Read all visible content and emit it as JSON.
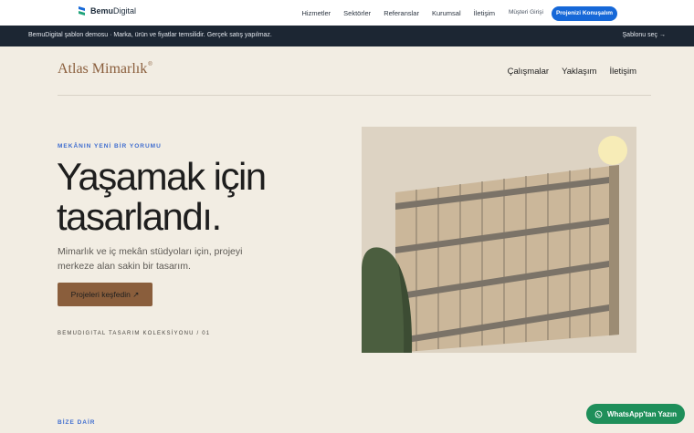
{
  "topnav": {
    "brand_bold": "Bemu",
    "brand_rest": "Digital",
    "links": [
      "Hizmetler",
      "Sektörler",
      "Referanslar",
      "Kurumsal",
      "İletişim"
    ],
    "login": "Müşteri Girişi",
    "cta": "Projenizi Konuşalım"
  },
  "banner": {
    "text": "BemuDigital şablon demosu · Marka, ürün ve fiyatlar temsilidir. Gerçek satış yapılmaz.",
    "link": "Şablonu seç →"
  },
  "site": {
    "logo": "Atlas Mimarlık",
    "logo_mark": "®",
    "nav": [
      "Çalışmalar",
      "Yaklaşım",
      "İletişim"
    ]
  },
  "hero": {
    "eyebrow": "MEKÂNIN YENİ BİR YORUMU",
    "headline_line1": "Yaşamak için",
    "headline_line2": "tasarlandı.",
    "subcopy": "Mimarlık ve iç mekân stüdyoları için, projeyi merkeze alan sakin bir tasarım.",
    "button": "Projeleri keşfedin ↗",
    "collection": "BEMUDIGITAL TASARIM KOLEKSİYONU / 01"
  },
  "about": {
    "eyebrow": "BİZE DAİR"
  },
  "whatsapp": {
    "label": "WhatsApp'tan Yazın"
  },
  "colors": {
    "brand_blue": "#1668d8",
    "accent_brown": "#8a5e3c",
    "banner_bg": "#1c2633",
    "page_bg": "#f2ede3",
    "whatsapp_green": "#1f8f5a"
  },
  "icons": [
    "bemudigital-logo-icon",
    "whatsapp-icon",
    "sun-icon"
  ]
}
